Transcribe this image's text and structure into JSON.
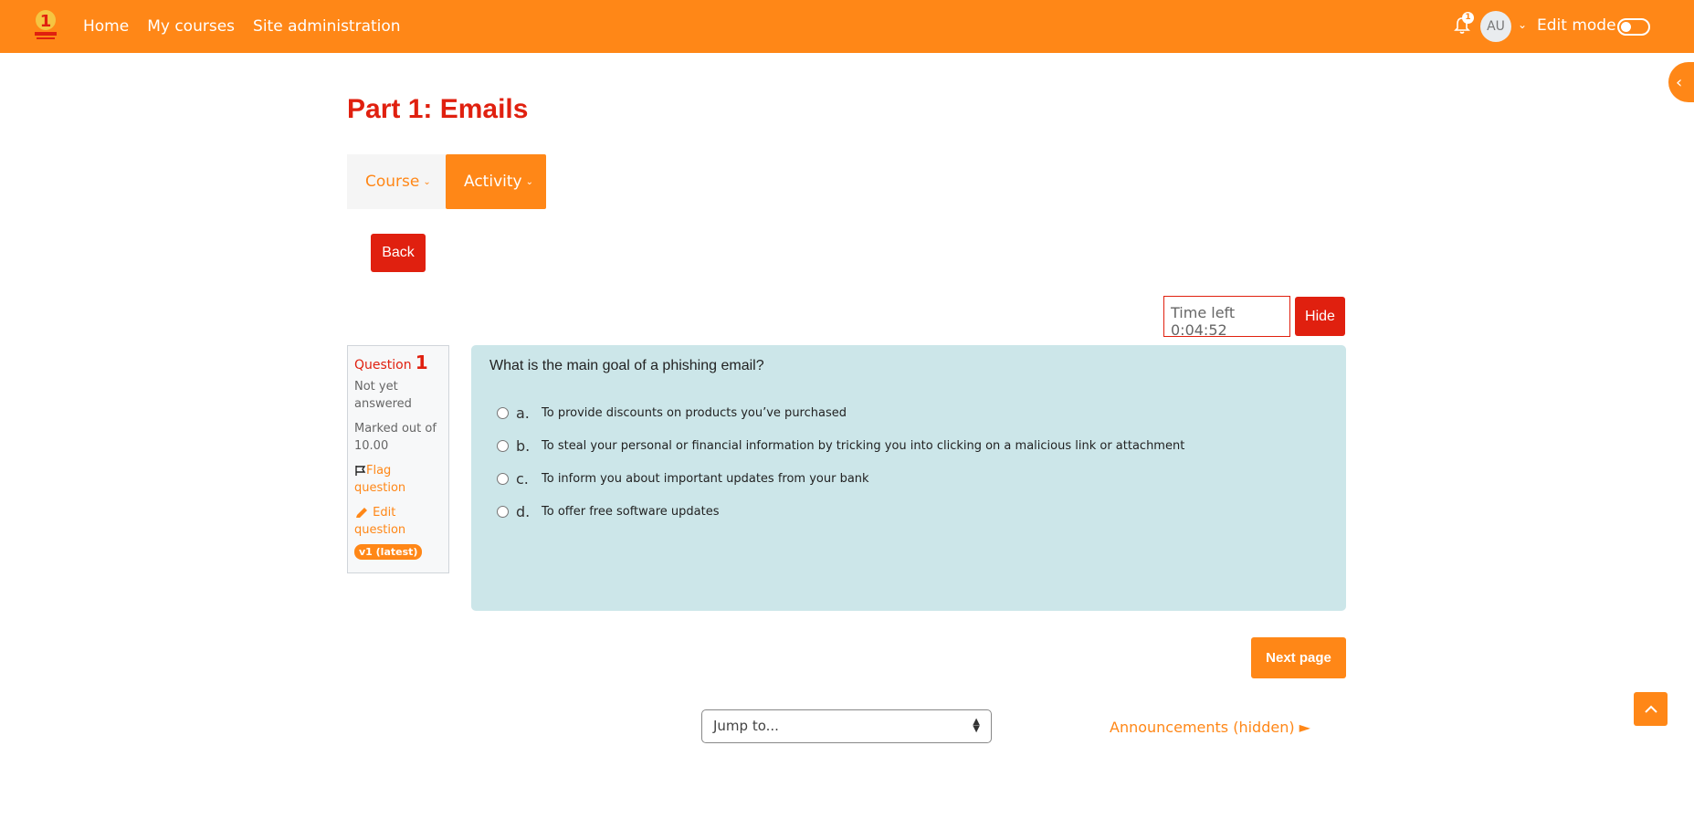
{
  "navbar": {
    "links": [
      "Home",
      "My courses",
      "Site administration"
    ],
    "notification_count": "1",
    "avatar_initials": "AU",
    "edit_mode_label": "Edit mode",
    "accent_color": "#ff8717"
  },
  "page": {
    "title": "Part 1: Emails"
  },
  "secondary_nav": {
    "course_label": "Course",
    "activity_label": "Activity"
  },
  "back_label": "Back",
  "timer": {
    "text": "Time left 0:04:52",
    "hide_label": "Hide"
  },
  "question_info": {
    "label": "Question",
    "number": "1",
    "status": "Not yet answered",
    "marked": "Marked out of 10.00",
    "flag_label": "Flag question",
    "edit_label": "Edit question",
    "version": "v1 (latest)"
  },
  "question": {
    "text": "What is the main goal of a phishing email?",
    "answers": [
      {
        "letter": "a.",
        "text": "To provide discounts on products you’ve purchased"
      },
      {
        "letter": "b.",
        "text": "To steal your personal or financial information by tricking you into clicking on a malicious link or attachment"
      },
      {
        "letter": "c.",
        "text": "To inform you about important updates from your bank"
      },
      {
        "letter": "d.",
        "text": "To offer free software updates"
      }
    ]
  },
  "next_page_label": "Next page",
  "jump": {
    "selected": "Jump to..."
  },
  "next_activity": {
    "label": "Announcements (hidden) ►"
  }
}
